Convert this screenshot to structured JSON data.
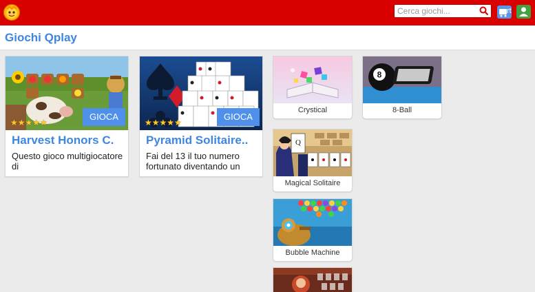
{
  "header": {
    "search": {
      "placeholder": "Cerca giochi..."
    },
    "cart_label": "rt",
    "colors": {
      "bar": "#d90000",
      "accent": "#3f86e0",
      "cart": "#5b95e6",
      "user": "#45a142"
    },
    "icons": [
      "logo-icon",
      "search-icon",
      "cart-icon",
      "user-icon"
    ]
  },
  "page": {
    "title": "Giochi Qplay"
  },
  "featured": [
    {
      "name": "Harvest Honors C.",
      "description": "Questo gioco multigiocatore di",
      "play_label": "GIOCA",
      "stars": "★★★★★",
      "rating": 5
    },
    {
      "name": "Pyramid Solitaire..",
      "description": "Fai del 13 il tuo numero fortunato diventando un",
      "play_label": "GIOCA",
      "stars": "★★★★★",
      "rating": 5
    }
  ],
  "games": [
    {
      "name": "Crystical"
    },
    {
      "name": "8-Ball"
    },
    {
      "name": "Magical Solitaire"
    },
    {
      "name": "Bubble Machine"
    }
  ]
}
